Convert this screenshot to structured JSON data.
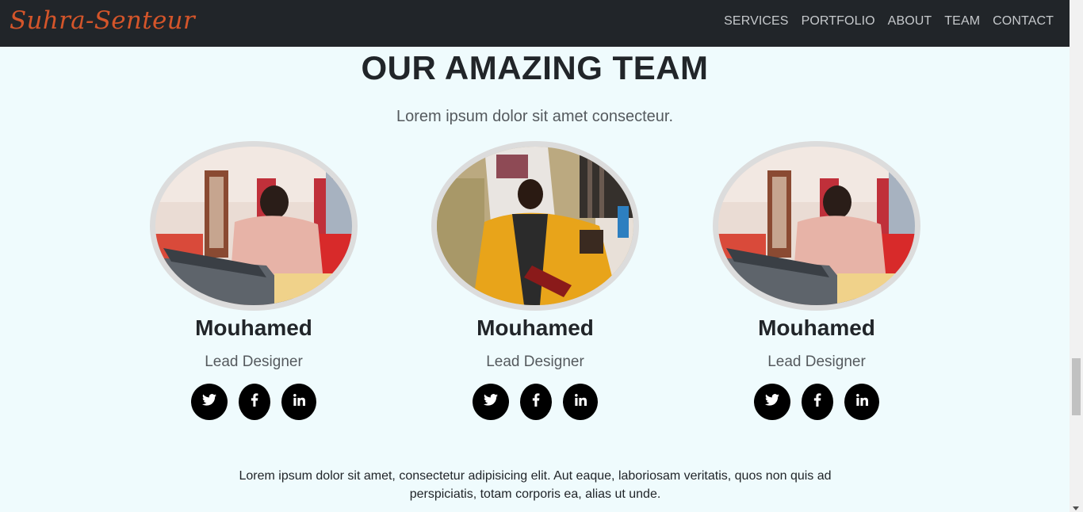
{
  "nav": {
    "brand": "Suhra-Senteur",
    "links": [
      "SERVICES",
      "PORTFOLIO",
      "ABOUT",
      "TEAM",
      "CONTACT"
    ]
  },
  "team": {
    "title": "OUR AMAZING TEAM",
    "subtitle": "Lorem ipsum dolor sit amet consecteur.",
    "members": [
      {
        "name": "Mouhamed",
        "role": "Lead Designer",
        "socials": [
          "twitter-icon",
          "facebook-icon",
          "linkedin-icon"
        ]
      },
      {
        "name": "Mouhamed",
        "role": "Lead Designer",
        "socials": [
          "twitter-icon",
          "facebook-icon",
          "linkedin-icon"
        ]
      },
      {
        "name": "Mouhamed",
        "role": "Lead Designer",
        "socials": [
          "twitter-icon",
          "facebook-icon",
          "linkedin-icon"
        ]
      }
    ],
    "footer_text": "Lorem ipsum dolor sit amet, consectetur adipisicing elit. Aut eaque, laboriosam veritatis, quos non quis ad perspiciatis, totam corporis ea, alias ut unde."
  },
  "colors": {
    "navbar": "#212529",
    "brand": "#d4552a",
    "background": "#effbfd",
    "social_button": "#000000"
  }
}
